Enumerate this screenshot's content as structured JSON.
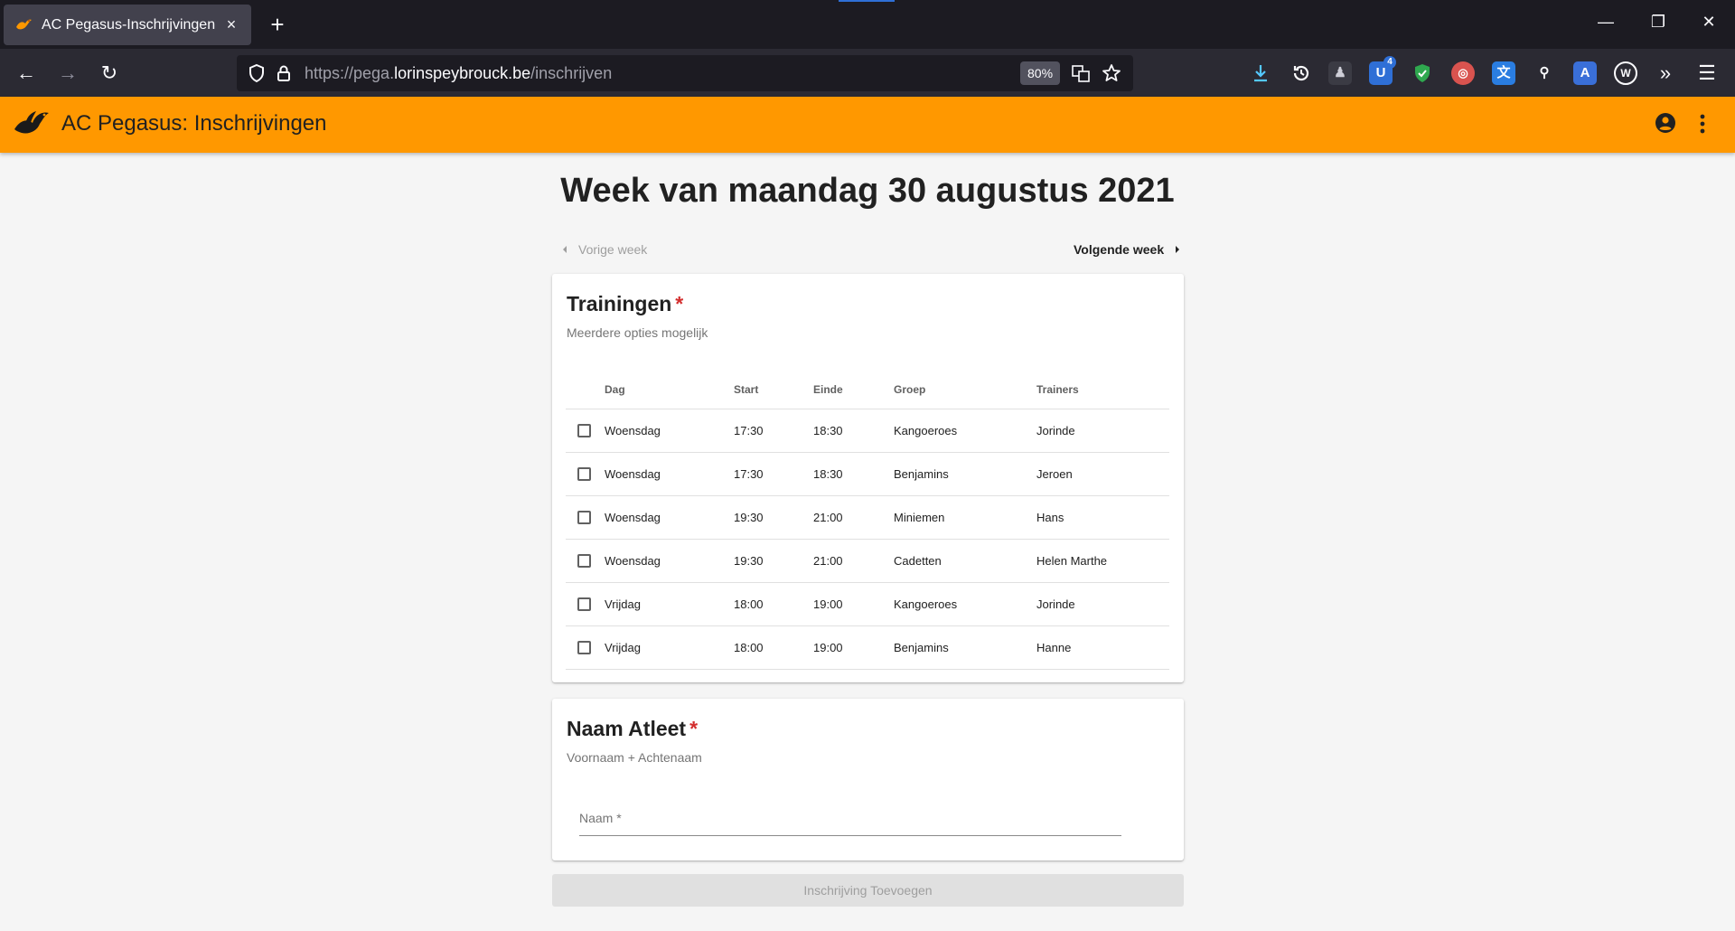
{
  "browser": {
    "tab_title": "AC Pegasus-Inschrijvingen",
    "tab_close": "×",
    "new_tab": "+",
    "url_prefix": "https://pega.",
    "url_domain": "lorinspeybrouck.be",
    "url_path": "/inschrijven",
    "zoom": "80%",
    "extension_badge": "4",
    "window": {
      "minimize": "—",
      "restore": "❐",
      "close": "✕"
    },
    "nav": {
      "back": "←",
      "forward": "→",
      "reload": "↻",
      "overflow": "»",
      "menu": "☰"
    }
  },
  "app": {
    "title": "AC Pegasus: Inschrijvingen",
    "accent_color": "#ff9800"
  },
  "page": {
    "title": "Week van maandag 30 augustus 2021",
    "prev_week": "Vorige week",
    "next_week": "Volgende week"
  },
  "trainings": {
    "title": "Trainingen",
    "required_mark": "*",
    "subtitle": "Meerdere opties mogelijk",
    "columns": [
      "Dag",
      "Start",
      "Einde",
      "Groep",
      "Trainers"
    ],
    "rows": [
      {
        "day": "Woensdag",
        "start": "17:30",
        "end": "18:30",
        "group": "Kangoeroes",
        "trainers": "Jorinde"
      },
      {
        "day": "Woensdag",
        "start": "17:30",
        "end": "18:30",
        "group": "Benjamins",
        "trainers": "Jeroen"
      },
      {
        "day": "Woensdag",
        "start": "19:30",
        "end": "21:00",
        "group": "Miniemen",
        "trainers": "Hans"
      },
      {
        "day": "Woensdag",
        "start": "19:30",
        "end": "21:00",
        "group": "Cadetten",
        "trainers": "Helen Marthe"
      },
      {
        "day": "Vrijdag",
        "start": "18:00",
        "end": "19:00",
        "group": "Kangoeroes",
        "trainers": "Jorinde"
      },
      {
        "day": "Vrijdag",
        "start": "18:00",
        "end": "19:00",
        "group": "Benjamins",
        "trainers": "Hanne"
      }
    ]
  },
  "athlete": {
    "title": "Naam Atleet",
    "required_mark": "*",
    "subtitle": "Voornaam + Achtenaam",
    "field_label": "Naam *"
  },
  "submit_label": "Inschrijving Toevoegen"
}
